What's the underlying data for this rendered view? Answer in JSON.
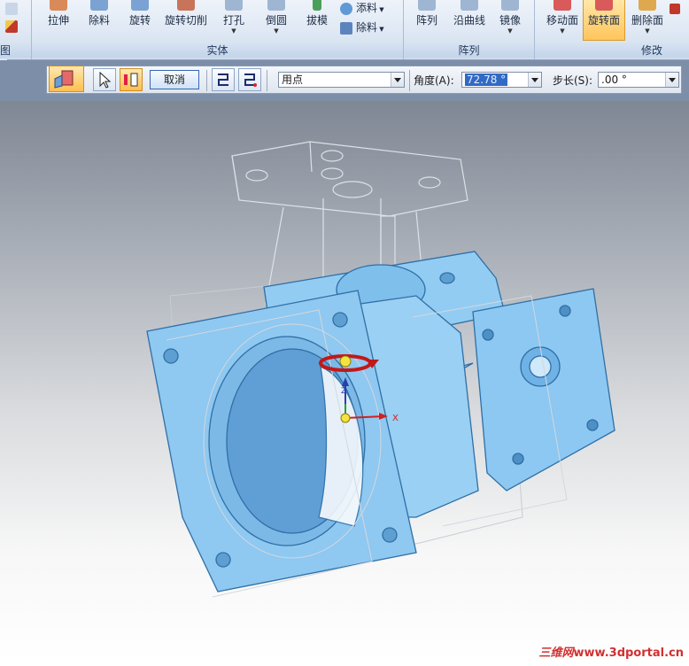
{
  "ribbon": {
    "left_group_label": "图",
    "solid_group": {
      "label": "实体",
      "buttons": [
        "拉伸",
        "除料",
        "旋转",
        "旋转切削",
        "打孔",
        "倒圆",
        "拔模"
      ],
      "small_buttons": [
        "添料",
        "除料"
      ]
    },
    "pattern_group": {
      "label": "阵列",
      "buttons": [
        "阵列",
        "沿曲线",
        "镜像"
      ]
    },
    "modify_group": {
      "label": "修改",
      "buttons": [
        "移动面",
        "旋转面",
        "删除面"
      ],
      "active": "旋转面"
    }
  },
  "command_bar": {
    "cancel_label": "取消",
    "select_mode": "用点",
    "angle_label": "角度(A):",
    "angle_value": "72.78 °",
    "step_label": "步长(S):",
    "step_value": ".00 °"
  },
  "viewport": {
    "axis_x_label": "X",
    "axis_z_label": "Z"
  },
  "watermark": {
    "cn": "三维网",
    "url": "www.3dportal.cn"
  },
  "colors": {
    "part_fill": "#8fc8f0",
    "part_edge": "#3d7fb5",
    "ghost_edge": "#c9cfd8",
    "accent_red": "#d42020",
    "ribbon_active": "#ffc55c"
  }
}
